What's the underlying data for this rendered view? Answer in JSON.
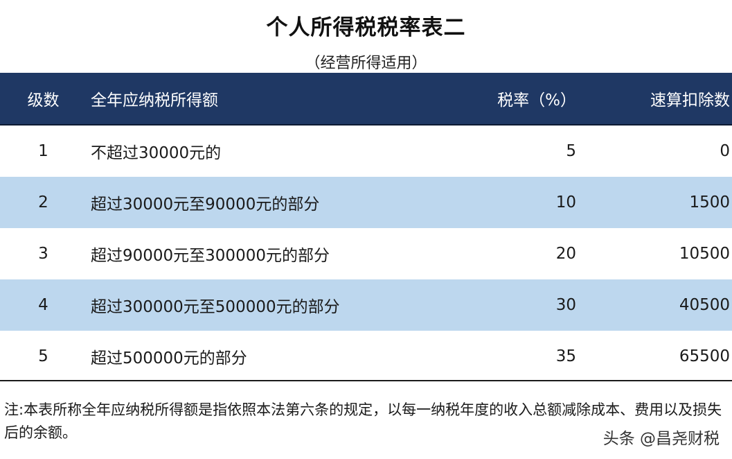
{
  "title": "个人所得税税率表二",
  "subtitle": "（经营所得适用）",
  "table": {
    "headers": {
      "level": "级数",
      "range": "全年应纳税所得额",
      "rate": "税率（%）",
      "deduction": "速算扣除数"
    },
    "rows": [
      {
        "level": "1",
        "range": "不超过30000元的",
        "rate": "5",
        "deduction": "0"
      },
      {
        "level": "2",
        "range": "超过30000元至90000元的部分",
        "rate": "10",
        "deduction": "1500"
      },
      {
        "level": "3",
        "range": "超过90000元至300000元的部分",
        "rate": "20",
        "deduction": "10500"
      },
      {
        "level": "4",
        "range": "超过300000元至500000元的部分",
        "rate": "30",
        "deduction": "40500"
      },
      {
        "level": "5",
        "range": "超过500000元的部分",
        "rate": "35",
        "deduction": "65500"
      }
    ]
  },
  "note": "注:本表所称全年应纳税所得额是指依照本法第六条的规定，以每一纳税年度的收入总额减除成本、费用以及损失后的余额。",
  "watermark": "头条 @昌尧财税",
  "colors": {
    "header_bg": "#1f3864",
    "header_text": "#ffffff",
    "alt_row_bg": "#bdd7ee",
    "plain_row_bg": "#ffffff"
  }
}
